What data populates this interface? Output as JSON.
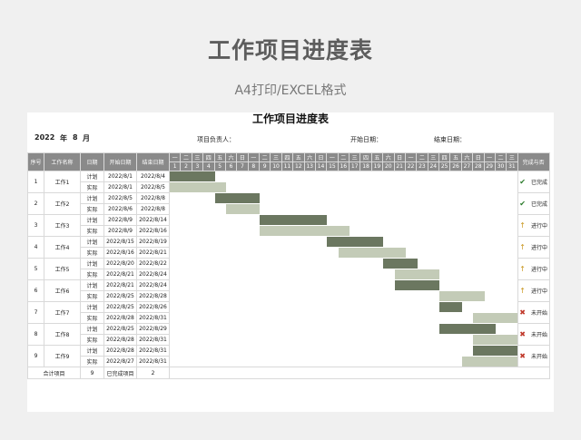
{
  "page": {
    "title": "工作项目进度表",
    "subtitle": "A4打印/EXCEL格式"
  },
  "sheet": {
    "title": "工作项目进度表",
    "year": "2022",
    "year_label": "年",
    "month": "8",
    "month_label": "月",
    "owner_label": "项目负责人：",
    "start_label": "开始日期：",
    "end_label": "结束日期："
  },
  "headers": {
    "seq": "序号",
    "name": "工作名称",
    "type": "日期",
    "start": "开始日期",
    "end": "结束日期",
    "status": "完成与否"
  },
  "weekdays": [
    "一",
    "二",
    "三",
    "四",
    "五",
    "六",
    "日",
    "一",
    "二",
    "三",
    "四",
    "五",
    "六",
    "日",
    "一",
    "二",
    "三",
    "四",
    "五",
    "六",
    "日",
    "一",
    "二",
    "三",
    "四",
    "五",
    "六",
    "日",
    "一",
    "二",
    "三"
  ],
  "days": [
    "1",
    "2",
    "3",
    "4",
    "5",
    "6",
    "7",
    "8",
    "9",
    "10",
    "11",
    "12",
    "13",
    "14",
    "15",
    "16",
    "17",
    "18",
    "19",
    "20",
    "21",
    "22",
    "23",
    "24",
    "25",
    "26",
    "27",
    "28",
    "29",
    "30",
    "31"
  ],
  "tasks": [
    {
      "seq": "1",
      "name": "工作1",
      "plan_label": "计划",
      "actual_label": "实际",
      "plan_start": "2022/8/1",
      "plan_end": "2022/8/4",
      "actual_start": "2022/8/1",
      "actual_end": "2022/8/5",
      "status": "已完成",
      "status_icon": "check-icon"
    },
    {
      "seq": "2",
      "name": "工作2",
      "plan_label": "计划",
      "actual_label": "实际",
      "plan_start": "2022/8/5",
      "plan_end": "2022/8/8",
      "actual_start": "2022/8/6",
      "actual_end": "2022/8/8",
      "status": "已完成",
      "status_icon": "check-icon"
    },
    {
      "seq": "3",
      "name": "工作3",
      "plan_label": "计划",
      "actual_label": "实际",
      "plan_start": "2022/8/9",
      "plan_end": "2022/8/14",
      "actual_start": "2022/8/9",
      "actual_end": "2022/8/16",
      "status": "进行中",
      "status_icon": "arrow-up-icon"
    },
    {
      "seq": "4",
      "name": "工作4",
      "plan_label": "计划",
      "actual_label": "实际",
      "plan_start": "2022/8/15",
      "plan_end": "2022/8/19",
      "actual_start": "2022/8/16",
      "actual_end": "2022/8/21",
      "status": "进行中",
      "status_icon": "arrow-up-icon"
    },
    {
      "seq": "5",
      "name": "工作5",
      "plan_label": "计划",
      "actual_label": "实际",
      "plan_start": "2022/8/20",
      "plan_end": "2022/8/22",
      "actual_start": "2022/8/21",
      "actual_end": "2022/8/24",
      "status": "进行中",
      "status_icon": "arrow-up-icon"
    },
    {
      "seq": "6",
      "name": "工作6",
      "plan_label": "计划",
      "actual_label": "实际",
      "plan_start": "2022/8/21",
      "plan_end": "2022/8/24",
      "actual_start": "2022/8/25",
      "actual_end": "2022/8/28",
      "status": "进行中",
      "status_icon": "arrow-up-icon"
    },
    {
      "seq": "7",
      "name": "工作7",
      "plan_label": "计划",
      "actual_label": "实际",
      "plan_start": "2022/8/25",
      "plan_end": "2022/8/26",
      "actual_start": "2022/8/28",
      "actual_end": "2022/8/31",
      "status": "未开始",
      "status_icon": "cross-icon"
    },
    {
      "seq": "8",
      "name": "工作8",
      "plan_label": "计划",
      "actual_label": "实际",
      "plan_start": "2022/8/25",
      "plan_end": "2022/8/29",
      "actual_start": "2022/8/28",
      "actual_end": "2022/8/31",
      "status": "未开始",
      "status_icon": "cross-icon"
    },
    {
      "seq": "9",
      "name": "工作9",
      "plan_label": "计划",
      "actual_label": "实际",
      "plan_start": "2022/8/28",
      "plan_end": "2022/8/31",
      "actual_start": "2022/8/27",
      "actual_end": "2022/8/31",
      "status": "未开始",
      "status_icon": "cross-icon"
    }
  ],
  "summary": {
    "total_label": "合计项目",
    "total": "9",
    "done_label": "已完成项目",
    "done": "2"
  },
  "colors": {
    "plan_bar": "#6b7760",
    "actual_bar": "#c3cbb7",
    "header_bg": "#8a8a8a",
    "check": "#2a7a2a",
    "arrow": "#c8961e",
    "cross": "#c0392b"
  }
}
